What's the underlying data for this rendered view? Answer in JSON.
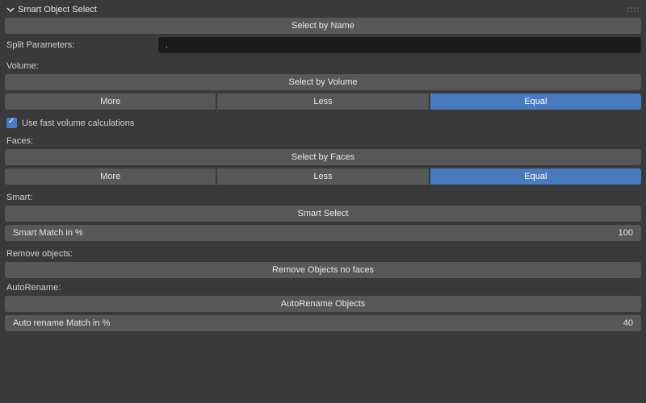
{
  "header": {
    "title": "Smart Object Select"
  },
  "select_name": {
    "button": "Select by Name"
  },
  "split": {
    "label": "Split Parameters:",
    "value": "."
  },
  "volume": {
    "label": "Volume:",
    "button": "Select by  Volume",
    "more": "More",
    "less": "Less",
    "equal": "Equal"
  },
  "fast": {
    "label": "Use fast volume calculations",
    "checked": true
  },
  "faces": {
    "label": "Faces:",
    "button": "Select by Faces",
    "more": "More",
    "less": "Less",
    "equal": "Equal"
  },
  "smart": {
    "label": "Smart:",
    "button": "Smart Select",
    "field_label": "Smart Match in %",
    "value": "100"
  },
  "remove": {
    "label": "Remove objects:",
    "button": "Remove Objects no faces"
  },
  "autorename": {
    "label": "AutoRename:",
    "button": "AutoRename Objects",
    "field_label": "Auto rename Match in %",
    "value": "40"
  }
}
